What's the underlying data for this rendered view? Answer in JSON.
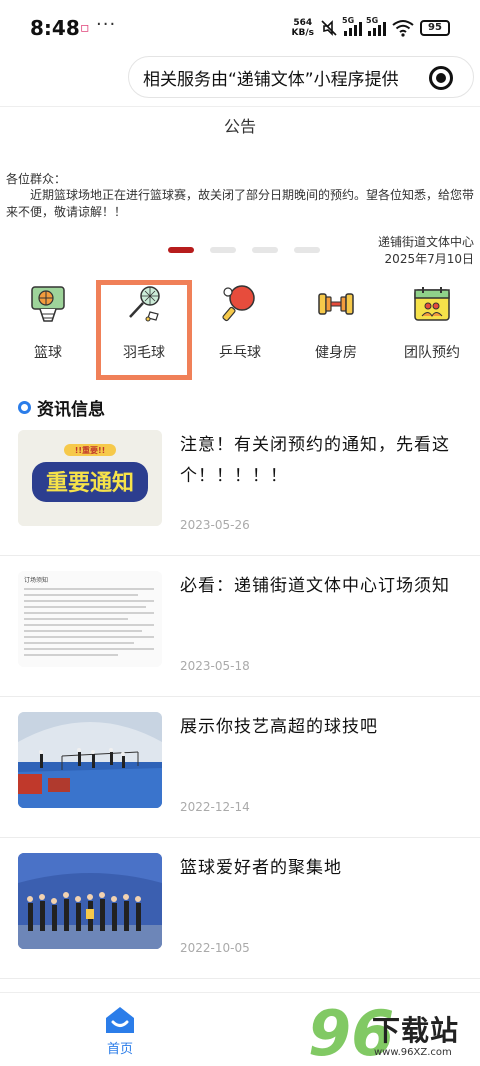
{
  "status": {
    "time": "8:48",
    "net_speed_value": "564",
    "net_speed_unit": "KB/s",
    "network_1": "5G",
    "network_2": "5G",
    "battery": "95"
  },
  "banner": {
    "text": "相关服务由“递铺文体”小程序提供"
  },
  "notice": {
    "title": "公告",
    "greeting": "各位群众：",
    "body": "近期篮球场地正在进行篮球赛，故关闭了部分日期晚间的预约。望各位知悉，给您带来不便，敬请谅解！！",
    "org": "递铺街道文体中心",
    "date": "2025年7月10日",
    "carousel_dots": 4,
    "carousel_active": 0
  },
  "categories": [
    {
      "label": "篮球",
      "icon": "basketball-hoop-icon"
    },
    {
      "label": "羽毛球",
      "icon": "badminton-icon"
    },
    {
      "label": "乒乓球",
      "icon": "table-tennis-icon"
    },
    {
      "label": "健身房",
      "icon": "dumbbell-icon"
    },
    {
      "label": "团队预约",
      "icon": "team-calendar-icon"
    }
  ],
  "section": {
    "title": "资讯信息"
  },
  "news": [
    {
      "title": "注意！有关闭预约的通知，先看这个！！！！！",
      "date": "2023-05-26",
      "thumb_text": "重要通知",
      "thumb_badge": "!!重要!!"
    },
    {
      "title": "必看：递铺街道文体中心订场须知",
      "date": "2023-05-18",
      "thumb_text": "订场须知"
    },
    {
      "title": "展示你技艺高超的球技吧",
      "date": "2022-12-14"
    },
    {
      "title": "篮球爱好者的聚集地",
      "date": "2022-10-05"
    }
  ],
  "bottom_nav": {
    "home_label": "首页"
  },
  "watermark": {
    "number": "96",
    "text": "下载站",
    "url": "www.96XZ.com"
  },
  "colors": {
    "accent": "#2b7de9",
    "carousel_active": "#b71c1c",
    "highlight_box": "#f08058"
  }
}
